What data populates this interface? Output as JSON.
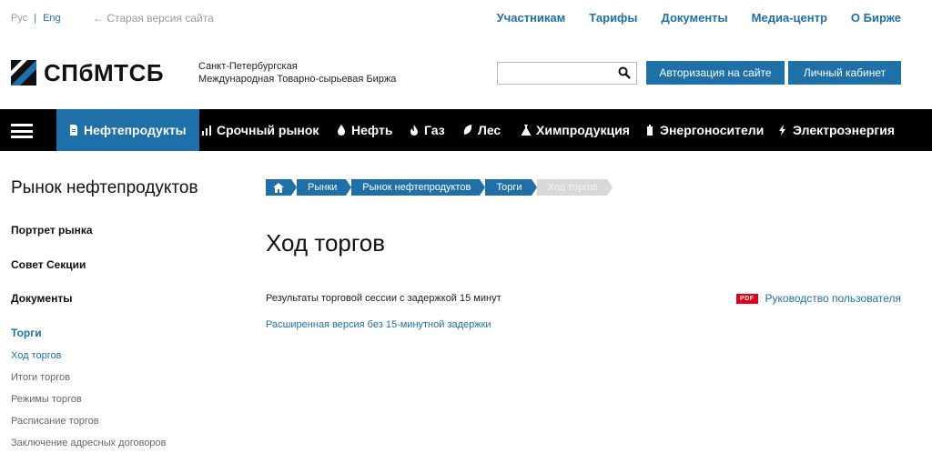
{
  "topbar": {
    "lang_ru": "Рус",
    "lang_sep": "|",
    "lang_en": "Eng",
    "old_site": "← Старая версия сайта",
    "nav": [
      "Участникам",
      "Тарифы",
      "Документы",
      "Медиа-центр",
      "О Бирже"
    ]
  },
  "header": {
    "logo_text": "СПбМТСБ",
    "org_line1": "Санкт-Петербургская",
    "org_line2": "Международная Товарно-сырьевая Биржа",
    "search_placeholder": "",
    "auth_button": "Авторизация на сайте",
    "cabinet_button": "Личный кабинет"
  },
  "mainnav": {
    "items": [
      "Нефтепродукты",
      "Срочный рынок",
      "Нефть",
      "Газ",
      "Лес",
      "Химпродукция",
      "Энергоносители",
      "Электроэнергия"
    ],
    "active_index": 0
  },
  "sidebar": {
    "title": "Рынок нефтепродуктов",
    "sections": [
      "Портрет рынка",
      "Совет Секции",
      "Документы",
      "Торги"
    ],
    "subitems": [
      "Ход торгов",
      "Итоги торгов",
      "Режимы торгов",
      "Расписание торгов",
      "Заключение адресных договоров"
    ]
  },
  "breadcrumb": [
    "Рынки",
    "Рынок нефтепродуктов",
    "Торги",
    "Ход торгов"
  ],
  "content": {
    "title": "Ход торгов",
    "result_text": "Результаты торговой сессии с задержкой 15 минут",
    "extended_link": "Расширенная версия без 15-минутной задержки",
    "pdf_badge": "PDF",
    "guide_link": "Руководство пользователя"
  },
  "colors": {
    "accent": "#1f6fa8",
    "nav_bg": "#000000",
    "pdf": "#e1001a"
  }
}
